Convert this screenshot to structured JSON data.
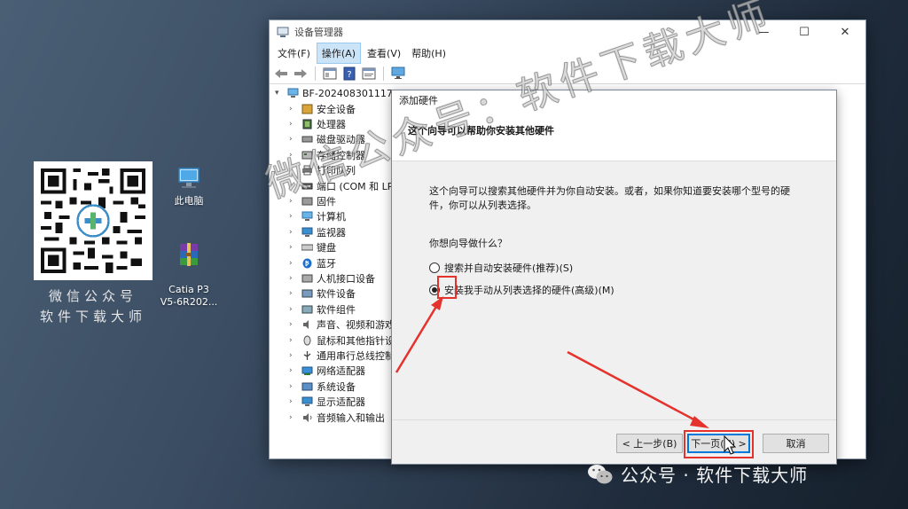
{
  "desktop": {
    "qr_caption_line1": "微信公众号",
    "qr_caption_line2": "软件下载大师",
    "icons": [
      {
        "name": "此电脑",
        "icon": "computer-icon"
      },
      {
        "name": "Catia P3\nV5-6R202...",
        "icon": "winrar-archive-icon"
      }
    ]
  },
  "device_manager": {
    "title": "设备管理器",
    "window_controls": [
      "—",
      "☐",
      "✕"
    ],
    "menu": [
      "文件(F)",
      "操作(A)",
      "查看(V)",
      "帮助(H)"
    ],
    "active_menu": "操作(A)",
    "tree_root": "BF-202408301117",
    "tree_items": [
      "安全设备",
      "处理器",
      "磁盘驱动器",
      "存储控制器",
      "打印队列",
      "端口 (COM 和 LP",
      "固件",
      "计算机",
      "监视器",
      "键盘",
      "蓝牙",
      "人机接口设备",
      "软件设备",
      "软件组件",
      "声音、视频和游戏",
      "鼠标和其他指针设",
      "通用串行总线控制",
      "网络适配器",
      "系统设备",
      "显示适配器",
      "音频输入和输出"
    ]
  },
  "dialog": {
    "title": "添加硬件",
    "header": "这个向导可以帮助你安装其他硬件",
    "description": "这个向导可以搜索其他硬件并为你自动安装。或者，如果你知道要安装哪个型号的硬件，你可以从列表选择。",
    "question": "你想向导做什么？",
    "options": [
      {
        "label": "搜索并自动安装硬件(推荐)(S)",
        "selected": false
      },
      {
        "label": "安装我手动从列表选择的硬件(高级)(M)",
        "selected": true
      }
    ],
    "buttons": {
      "back": "< 上一步(B)",
      "next": "下一页(N) >",
      "cancel": "取消"
    }
  },
  "overlay": {
    "watermark": "微信公众号：软件下载大师",
    "brand": "公众号 · 软件下载大师",
    "highlight_color": "#e5322d"
  }
}
